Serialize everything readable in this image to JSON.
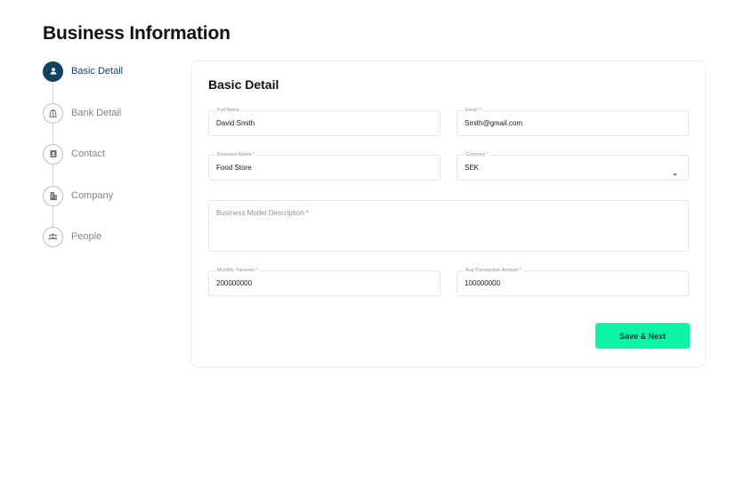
{
  "page": {
    "title": "Business Information"
  },
  "stepper": {
    "steps": [
      {
        "label": "Basic Detail",
        "icon": "person-icon",
        "active": true
      },
      {
        "label": "Bank Detail",
        "icon": "bank-icon",
        "active": false
      },
      {
        "label": "Contact",
        "icon": "contact-card-icon",
        "active": false
      },
      {
        "label": "Company",
        "icon": "building-icon",
        "active": false
      },
      {
        "label": "People",
        "icon": "people-icon",
        "active": false
      }
    ]
  },
  "form": {
    "title": "Basic Detail",
    "full_name": {
      "label": "Full Name",
      "value": "David Smith"
    },
    "email": {
      "label": "Email *",
      "value": "Smith@gmail.com"
    },
    "business_name": {
      "label": "Business Name *",
      "value": "Food Store"
    },
    "currency": {
      "label": "Currency *",
      "value": "SEK"
    },
    "business_model_description": {
      "placeholder": "Business Model Description *"
    },
    "monthly_turnover": {
      "label": "Monthly Turnover *",
      "value": "200000000"
    },
    "avg_transaction_amount": {
      "label": "Avg Transaction Amount *",
      "value": "100000000"
    },
    "save_label": "Save & Next"
  },
  "colors": {
    "primary": "#12425e",
    "accent": "#0cf5a5"
  }
}
